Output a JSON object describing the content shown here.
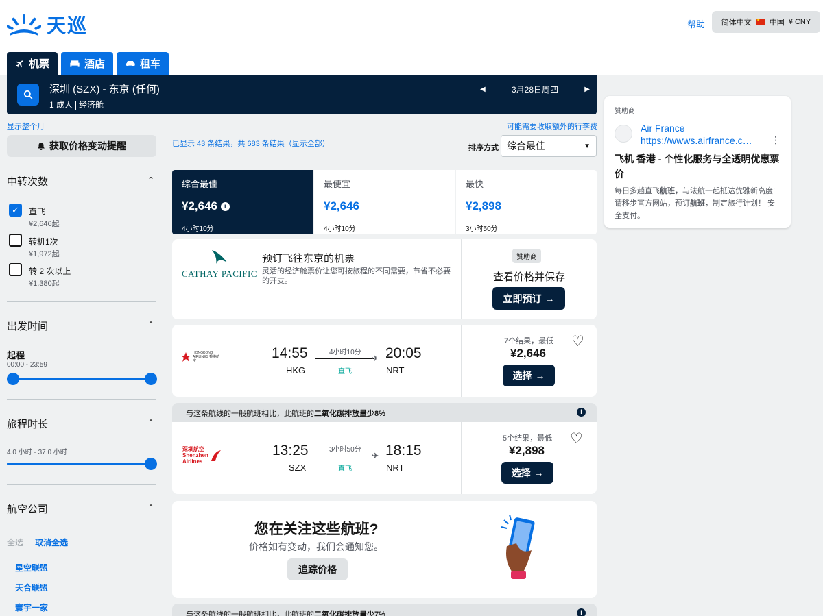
{
  "header": {
    "logo_text": "天巡",
    "help": "帮助",
    "locale": {
      "language": "简体中文",
      "country": "中国",
      "currency": "¥ CNY"
    }
  },
  "tabs": [
    {
      "label": "机票",
      "icon": "plane-icon",
      "active": true
    },
    {
      "label": "酒店",
      "icon": "bed-icon",
      "active": false
    },
    {
      "label": "租车",
      "icon": "car-icon",
      "active": false
    }
  ],
  "search": {
    "route": "深圳 (SZX) - 东京 (任何)",
    "passengers": "1 成人",
    "cabin": "经济舱",
    "date": "3月28日周四"
  },
  "links": {
    "show_month": "显示整个月",
    "extra_fees": "可能需要收取额外的行李费"
  },
  "price_alert": {
    "label": "获取价格变动提醒"
  },
  "filters": {
    "stops": {
      "title": "中转次数",
      "options": [
        {
          "label": "直飞",
          "price": "¥2,646起",
          "checked": true
        },
        {
          "label": "转机1次",
          "price": "¥1,972起",
          "checked": false
        },
        {
          "label": "转 2 次以上",
          "price": "¥1,380起",
          "checked": false
        }
      ]
    },
    "departure": {
      "title": "出发时间",
      "sub_title": "起程",
      "range": "00:00 - 23:59"
    },
    "duration": {
      "title": "旅程时长",
      "range": "4.0 小时 - 37.0 小时"
    },
    "airlines": {
      "title": "航空公司",
      "select_all": "全选",
      "deselect_all": "取消全选",
      "alliances": [
        "星空联盟",
        "天合联盟",
        "寰宇一家"
      ]
    }
  },
  "results": {
    "info": "已显示 43 条结果，共 683 条结果（显示全部）",
    "sort_label": "排序方式",
    "sort_value": "综合最佳"
  },
  "sort_tabs": [
    {
      "name": "综合最佳",
      "price": "¥2,646",
      "duration": "4小时10分"
    },
    {
      "name": "最便宜",
      "price": "¥2,646",
      "duration": "4小时10分"
    },
    {
      "name": "最快",
      "price": "¥2,898",
      "duration": "3小时50分"
    }
  ],
  "promo_card": {
    "airline": "CATHAY PACIFIC",
    "title": "预订飞往东京的机票",
    "desc": "灵活的经济舱票价让您可按旅程的不同需要，节省不必要的开支。",
    "badge": "赞助商",
    "cta_text": "查看价格并保存",
    "button": "立即预订"
  },
  "flights": [
    {
      "airline_logo": "HONGKONG AIRLINES 香港航空",
      "dep_time": "14:55",
      "dep_code": "HKG",
      "arr_time": "20:05",
      "arr_code": "NRT",
      "duration": "4小时10分",
      "stops": "直飞",
      "results_count": "7个结果，最低",
      "price": "¥2,646",
      "button": "选择"
    },
    {
      "co2_note_prefix": "与这条航线的一般航班相比，此航班的",
      "co2_note_bold": "二氧化碳排放量少8%",
      "airline_logo": "深圳航空 Shenzhen Airlines",
      "dep_time": "13:25",
      "dep_code": "SZX",
      "arr_time": "18:15",
      "arr_code": "NRT",
      "duration": "3小时50分",
      "stops": "直飞",
      "results_count": "5个结果，最低",
      "price": "¥2,898",
      "button": "选择"
    }
  ],
  "track_card": {
    "title": "您在关注这些航班?",
    "subtitle": "价格如有变动，我们会通知您。",
    "button": "追踪价格"
  },
  "co2_bottom": {
    "prefix": "与这条航线的一般航班相比，此航班的",
    "bold": "二氧化碳排放量少7%"
  },
  "ad": {
    "label": "赞助商",
    "advertiser": "Air France",
    "url": "https://wwws.airfrance.c…",
    "title": "飞机 香港 - 个性化服务与全透明优惠票价",
    "desc_parts": [
      "每日多趟直飞",
      "航班",
      "，与法航一起抵达优雅新高度! 请移步官方网站，预订",
      "航班",
      "，制定旅行计划！ 安全支付。"
    ]
  },
  "colors": {
    "brand_blue": "#0770e3",
    "dark_navy": "#05203c",
    "background": "#eff1f2",
    "eco_green": "#00a698"
  }
}
